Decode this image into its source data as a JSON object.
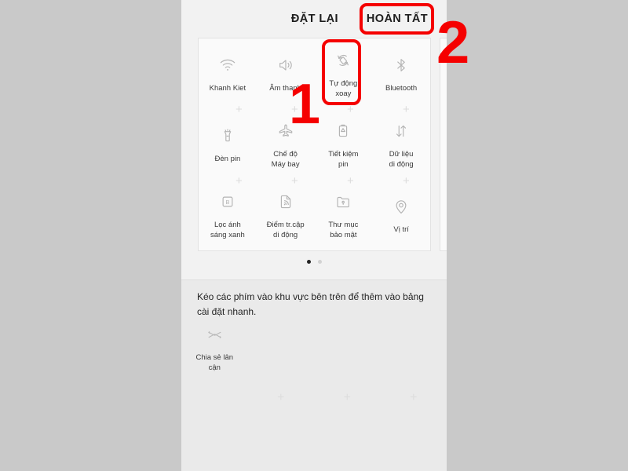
{
  "screen": {
    "background_color": "#c9c9c9",
    "panel_color": "#f2f2f2"
  },
  "action_bar": {
    "reset_label": "ĐẶT LẠI",
    "done_label": "HOÀN TẤT"
  },
  "quick_settings": {
    "tiles": [
      {
        "icon": "wifi-icon",
        "label": "Khanh Kiet"
      },
      {
        "icon": "sound-icon",
        "label": "Âm thanh"
      },
      {
        "icon": "auto-rotate-icon",
        "label": "Tự động\nxoay"
      },
      {
        "icon": "bluetooth-icon",
        "label": "Bluetooth"
      },
      {
        "icon": "flashlight-icon",
        "label": "Đèn pin"
      },
      {
        "icon": "airplane-icon",
        "label": "Chế độ\nMáy bay"
      },
      {
        "icon": "battery-saver-icon",
        "label": "Tiết kiệm\npin"
      },
      {
        "icon": "mobile-data-icon",
        "label": "Dữ liệu\ndi động"
      },
      {
        "icon": "blue-light-filter-icon",
        "label": "Lọc ánh\nsáng xanh"
      },
      {
        "icon": "hotspot-icon",
        "label": "Điểm tr.cập\ndi động"
      },
      {
        "icon": "secure-folder-icon",
        "label": "Thư mục\nbảo mật"
      },
      {
        "icon": "location-icon",
        "label": "Vị trí"
      }
    ],
    "page_dots": {
      "count": 2,
      "active_index": 0
    }
  },
  "drag_area": {
    "hint": "Kéo các phím vào khu vực bên trên để thêm vào bảng cài đặt nhanh.",
    "tiles": [
      {
        "icon": "nearby-share-icon",
        "label": "Chia sẻ lân\ncận"
      }
    ],
    "placeholder_symbol": "+",
    "placeholder_count": 3,
    "row_separator_symbol": "+"
  },
  "annotations": {
    "marker_one": "1",
    "marker_two": "2",
    "highlight_color": "#f50000",
    "boxes": [
      "done-button",
      "auto-rotate-tile"
    ]
  }
}
